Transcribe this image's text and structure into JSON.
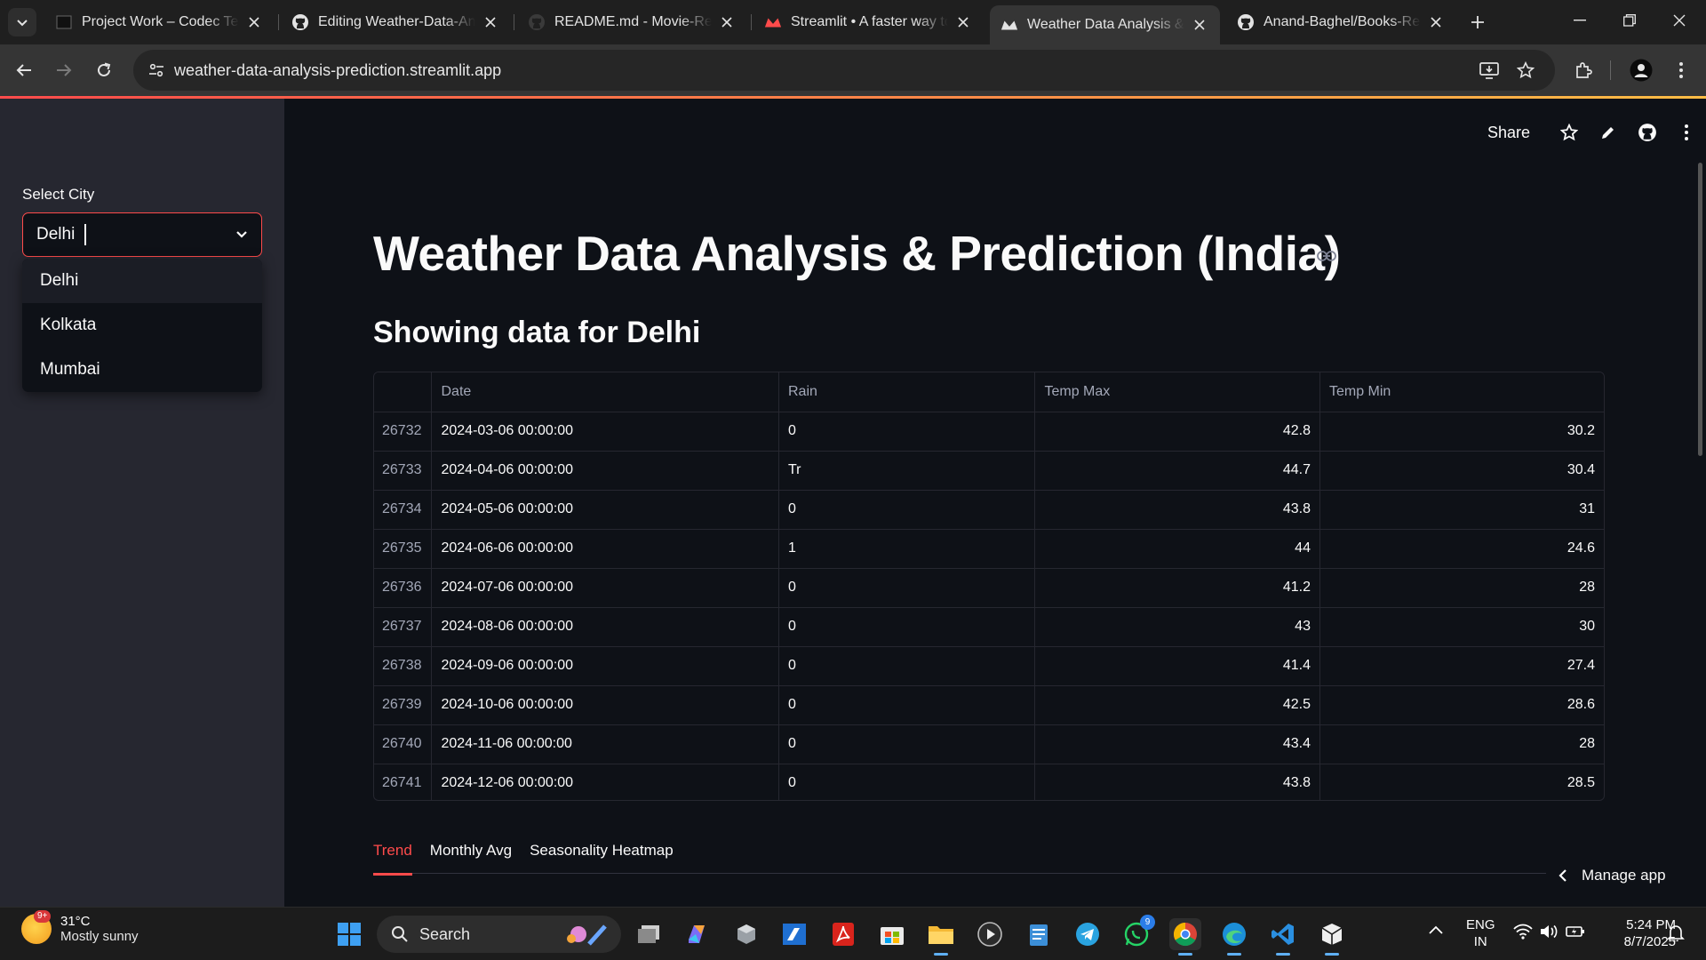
{
  "browser": {
    "tabs": [
      {
        "title": "Project Work – Codec Tech",
        "icon": "codec-favicon"
      },
      {
        "title": "Editing Weather-Data-Anal",
        "icon": "github-icon"
      },
      {
        "title": "README.md - Movie-Reco",
        "icon": "github-icon"
      },
      {
        "title": "Streamlit • A faster way to",
        "icon": "streamlit-icon"
      },
      {
        "title": "Weather Data Analysis & P",
        "icon": "streamlit-icon",
        "active": true
      },
      {
        "title": "Anand-Baghel/Books-Reco",
        "icon": "github-icon"
      }
    ],
    "url": "weather-data-analysis-prediction.streamlit.app"
  },
  "sidebar": {
    "select_label": "Select City",
    "selected_value": "Delhi",
    "options": [
      "Delhi",
      "Kolkata",
      "Mumbai"
    ]
  },
  "app_toolbar": {
    "share_label": "Share"
  },
  "main": {
    "title": "Weather Data Analysis & Prediction (India)",
    "subheader": "Showing data for Delhi",
    "table": {
      "columns": [
        "",
        "Date",
        "Rain",
        "Temp Max",
        "Temp Min"
      ],
      "rows": [
        [
          "26732",
          "2024-03-06 00:00:00",
          "0",
          "42.8",
          "30.2"
        ],
        [
          "26733",
          "2024-04-06 00:00:00",
          "Tr",
          "44.7",
          "30.4"
        ],
        [
          "26734",
          "2024-05-06 00:00:00",
          "0",
          "43.8",
          "31"
        ],
        [
          "26735",
          "2024-06-06 00:00:00",
          "1",
          "44",
          "24.6"
        ],
        [
          "26736",
          "2024-07-06 00:00:00",
          "0",
          "41.2",
          "28"
        ],
        [
          "26737",
          "2024-08-06 00:00:00",
          "0",
          "43",
          "30"
        ],
        [
          "26738",
          "2024-09-06 00:00:00",
          "0",
          "41.4",
          "27.4"
        ],
        [
          "26739",
          "2024-10-06 00:00:00",
          "0",
          "42.5",
          "28.6"
        ],
        [
          "26740",
          "2024-11-06 00:00:00",
          "0",
          "43.4",
          "28"
        ],
        [
          "26741",
          "2024-12-06 00:00:00",
          "0",
          "43.8",
          "28.5"
        ]
      ]
    },
    "tabs": [
      "Trend",
      "Monthly Avg",
      "Seasonality Heatmap"
    ],
    "active_tab": "Trend",
    "manage_app_label": "Manage app"
  },
  "taskbar": {
    "weather_temp": "31°C",
    "weather_desc": "Mostly sunny",
    "weather_badge": "9+",
    "search_label": "Search",
    "whatsapp_badge": "9",
    "lang_line1": "ENG",
    "lang_line2": "IN",
    "time": "5:24 PM",
    "date": "8/7/2025"
  },
  "colors": {
    "accent": "#ff4b4b",
    "app_bg": "#0e1117",
    "sidebar_bg": "#262730"
  }
}
